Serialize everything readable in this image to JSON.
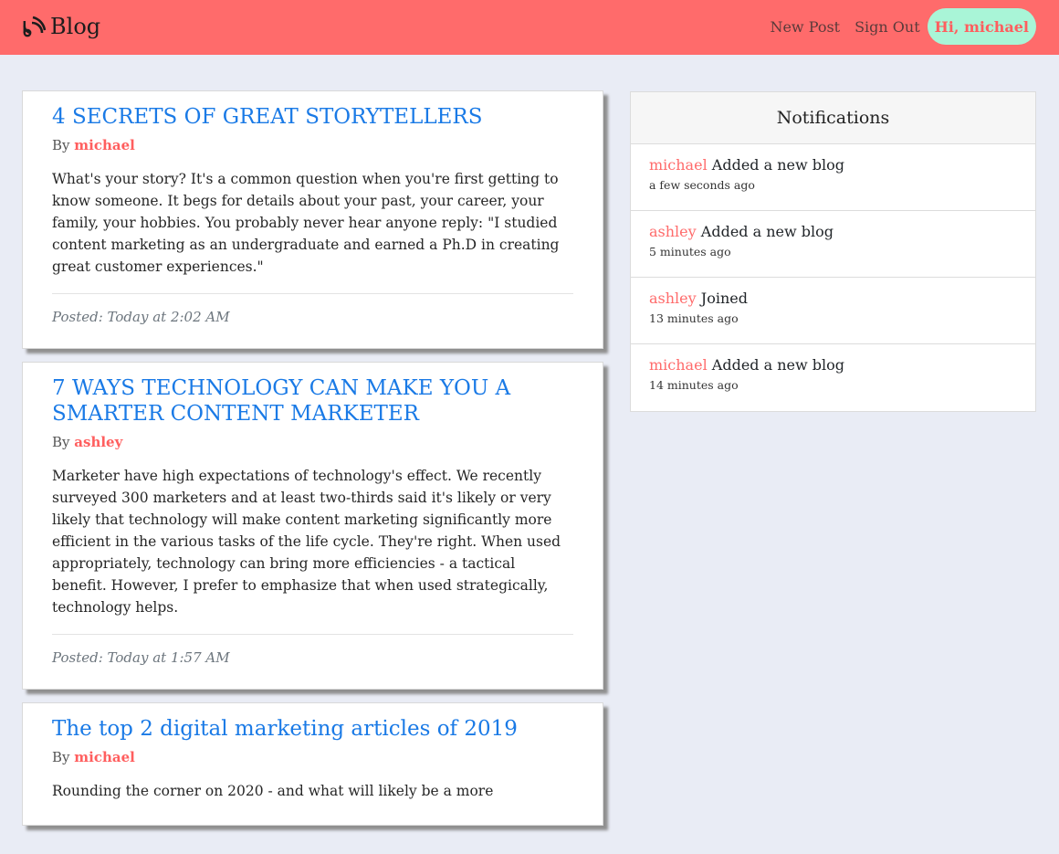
{
  "navbar": {
    "brand_text": "Blog",
    "brand_icon": "rss-icon",
    "new_post_label": "New Post",
    "sign_out_label": "Sign Out",
    "greeting": "Hi, michael"
  },
  "posts": [
    {
      "title": "4 SECRETS OF GREAT STORYTELLERS",
      "by_label": "By",
      "author": "michael",
      "body": "What's your story? It's a common question when you're first getting to know someone. It begs for details about your past, your career, your family, your hobbies. You probably never hear anyone reply: \"I studied content marketing as an undergraduate and earned a Ph.D in creating great customer experiences.\"",
      "posted": "Posted: Today at 2:02 AM"
    },
    {
      "title": "7 WAYS TECHNOLOGY CAN MAKE YOU A SMARTER CONTENT MARKETER",
      "by_label": "By",
      "author": "ashley",
      "body": "Marketer have high expectations of technology's effect. We recently surveyed 300 marketers and at least two-thirds said it's likely or very likely that technology will make content marketing significantly more efficient in the various tasks of the life cycle. They're right. When used appropriately, technology can bring more efficiencies - a tactical benefit. However, I prefer to emphasize that when used strategically, technology helps.",
      "posted": "Posted: Today at 1:57 AM"
    },
    {
      "title": "The top 2 digital marketing articles of 2019",
      "by_label": "By",
      "author": "michael",
      "body": "Rounding the corner on 2020 - and what will likely be a more",
      "posted": ""
    }
  ],
  "notifications": {
    "title": "Notifications",
    "items": [
      {
        "user": "michael",
        "action": "Added a new blog",
        "time": "a few seconds ago"
      },
      {
        "user": "ashley",
        "action": "Added a new blog",
        "time": "5 minutes ago"
      },
      {
        "user": "ashley",
        "action": "Joined",
        "time": "13 minutes ago"
      },
      {
        "user": "michael",
        "action": "Added a new blog",
        "time": "14 minutes ago"
      }
    ]
  },
  "colors": {
    "navbar": "#ff6b6b",
    "accent_link": "#1a7ae6",
    "author": "#ff5e5e",
    "greeting_bg": "#a9f5d7",
    "page_bg": "#e9ecf5"
  }
}
